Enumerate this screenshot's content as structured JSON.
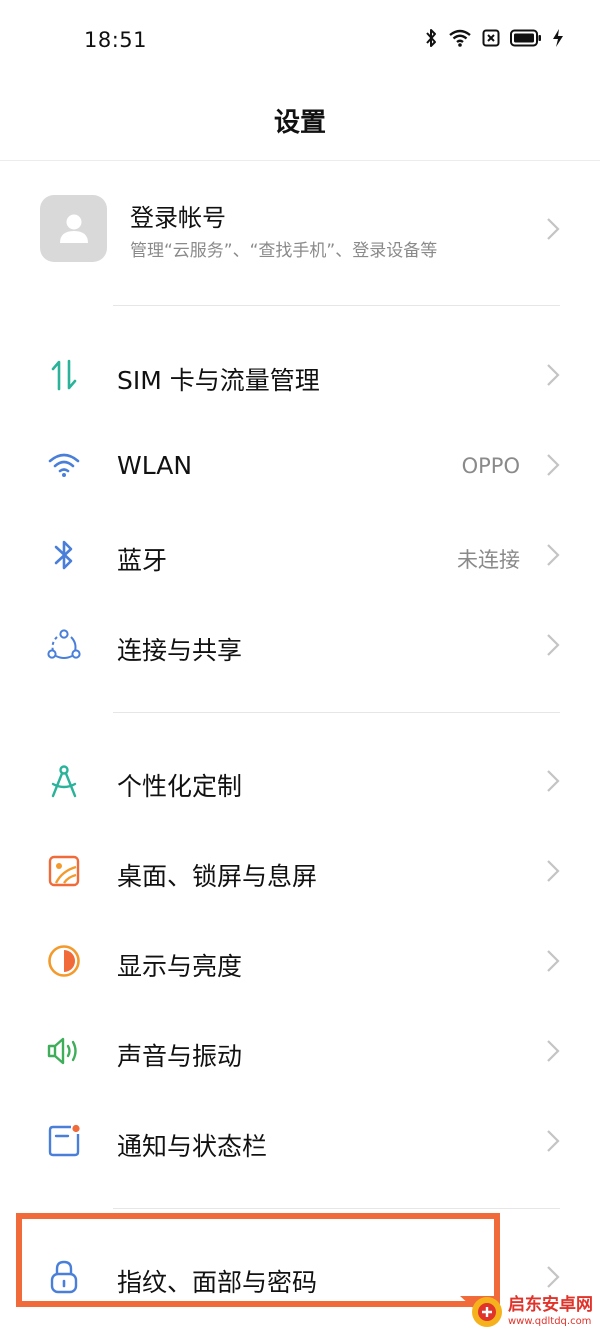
{
  "status_bar": {
    "time": "18:51"
  },
  "header": {
    "title": "设置"
  },
  "account": {
    "title": "登录帐号",
    "subtitle": "管理“云服务”、“查找手机”、登录设备等"
  },
  "settings": {
    "sim": {
      "label": "SIM 卡与流量管理",
      "icon": "sim-data-icon",
      "color": "#2ab39a"
    },
    "wlan": {
      "label": "WLAN",
      "value": "OPPO",
      "icon": "wifi-icon",
      "color": "#4a7fd9"
    },
    "bluetooth": {
      "label": "蓝牙",
      "value": "未连接",
      "icon": "bluetooth-icon",
      "color": "#4a7fd9"
    },
    "connection": {
      "label": "连接与共享",
      "icon": "connection-share-icon",
      "color": "#4a7fd9"
    },
    "personalize": {
      "label": "个性化定制",
      "icon": "compass-icon",
      "color": "#2ab39a"
    },
    "desktop": {
      "label": "桌面、锁屏与息屏",
      "icon": "wallpaper-icon",
      "color": "#f06a3a"
    },
    "display": {
      "label": "显示与亮度",
      "icon": "brightness-icon",
      "color": "#f39a2b"
    },
    "sound": {
      "label": "声音与振动",
      "icon": "speaker-icon",
      "color": "#3fae5a"
    },
    "notification": {
      "label": "通知与状态栏",
      "icon": "notification-icon",
      "color": "#4a7fd9"
    },
    "security": {
      "label": "指纹、面部与密码",
      "icon": "lock-icon",
      "color": "#4a7fd9"
    }
  },
  "watermark": {
    "brand": "启东安卓网",
    "url": "www.qdltdq.com"
  }
}
